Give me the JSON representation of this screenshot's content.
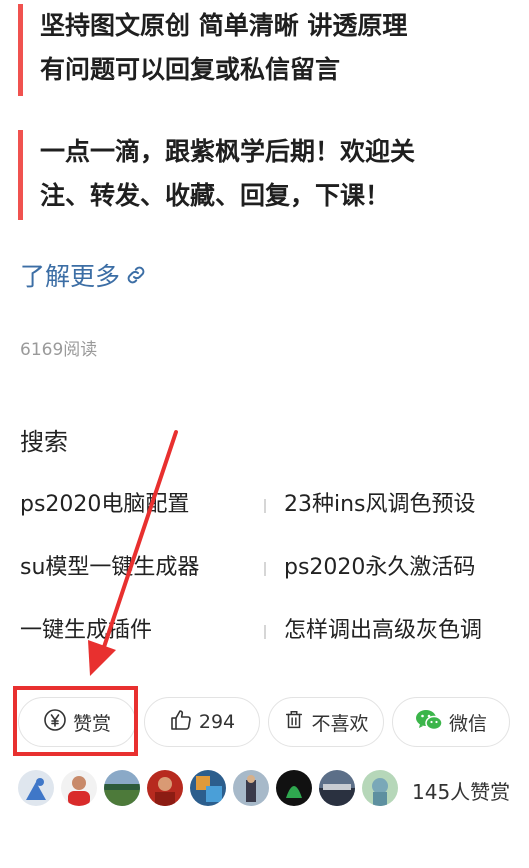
{
  "quotes": [
    {
      "line1": "坚持图文原创 简单清晰 讲透原理",
      "line2": "有问题可以回复或私信留言"
    },
    {
      "line1": "一点一滴，跟紫枫学后期！欢迎关",
      "line2": "注、转发、收藏、回复，下课！"
    }
  ],
  "learn_more": "了解更多",
  "read_count": "6169阅读",
  "search": {
    "heading": "搜索",
    "rows": [
      {
        "left": "ps2020电脑配置",
        "right": "23种ins风调色预设"
      },
      {
        "left": "su模型一键生成器",
        "right": "ps2020永久激活码"
      },
      {
        "left": "一键生成插件",
        "right": "怎样调出高级灰色调"
      }
    ]
  },
  "actions": {
    "reward_label": "赞赏",
    "like_count": "294",
    "dislike_label": "不喜欢",
    "wechat_label": "微信"
  },
  "reward_count": "145人赞赏",
  "colors": {
    "accent_bar": "#f0524f",
    "link": "#3c6ea5",
    "annotation_red": "#e8302f",
    "wechat_green": "#3bb54a"
  },
  "icons": [
    "yuan-icon",
    "thumbs-up-icon",
    "trash-icon",
    "wechat-icon",
    "link-icon"
  ]
}
